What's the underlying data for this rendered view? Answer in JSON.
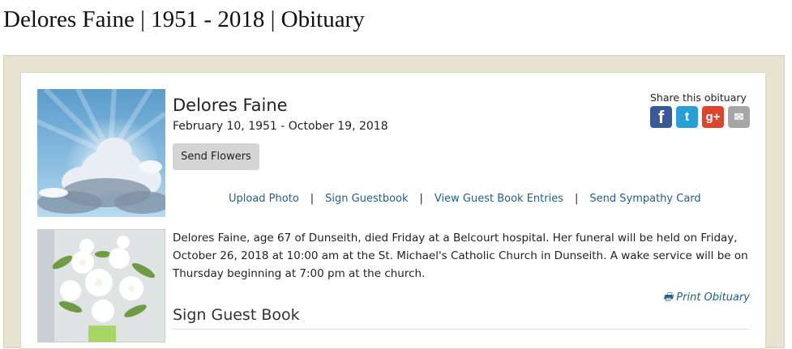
{
  "page": {
    "title": "Delores Faine | 1951 - 2018 | Obituary"
  },
  "obituary": {
    "name": "Delores Faine",
    "dates": "February 10, 1951 - October 19, 2018",
    "send_flowers_label": "Send Flowers",
    "share_label": "Share this obituary",
    "share_icons": [
      "facebook-icon",
      "twitter-icon",
      "google-plus-icon",
      "email-icon"
    ],
    "links": [
      {
        "label": "Upload Photo"
      },
      {
        "label": "Sign Guestbook"
      },
      {
        "label": "View Guest Book Entries"
      },
      {
        "label": "Send Sympathy Card"
      }
    ],
    "description": "Delores Faine, age 67 of Dunseith, died Friday at a Belcourt hospital.  Her funeral will be held on Friday, October 26, 2018 at 10:00 am at the St. Michael's Catholic Church in Dunseith.  A wake service will be on Thursday beginning at 7:00 pm at the church.",
    "print_label": "Print Obituary",
    "guest_book_heading": "Sign Guest Book"
  },
  "colors": {
    "link": "#1d5f8f",
    "frame": "#e7e3d0",
    "facebook": "#3b5998",
    "twitter": "#2a9fd6",
    "google_plus": "#d9452f",
    "email": "#a6a6a6"
  }
}
